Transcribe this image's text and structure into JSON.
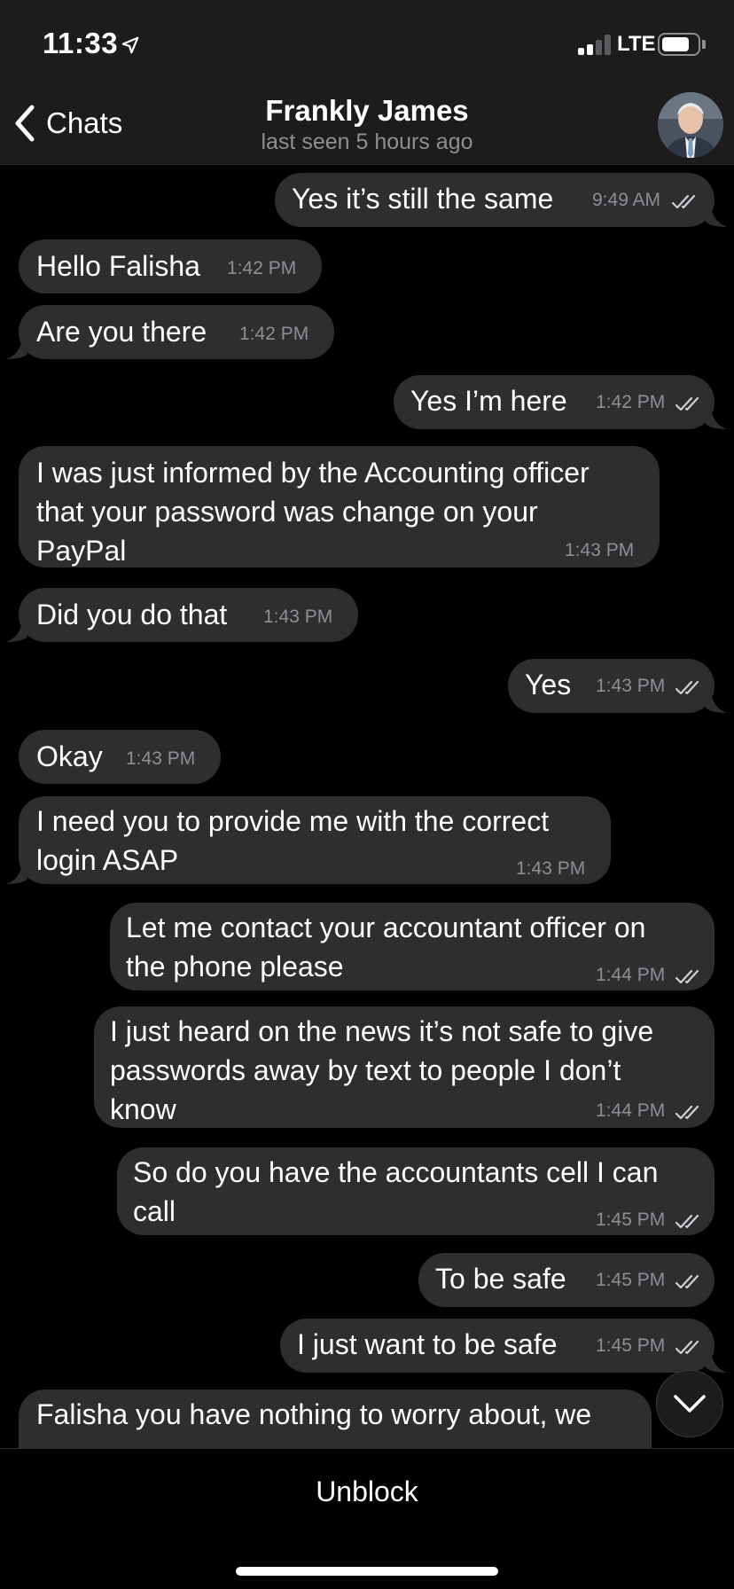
{
  "status_bar": {
    "time": "11:33",
    "network": "LTE",
    "battery_level": 0.75
  },
  "header": {
    "back_label": "Chats",
    "contact_name": "Frankly James",
    "last_seen": "last seen 5 hours ago"
  },
  "messages": [
    {
      "direction": "out",
      "text": "Yes it’s still the same",
      "time": "9:49 AM",
      "read": true
    },
    {
      "direction": "in",
      "text": "Hello Falisha",
      "time": "1:42 PM"
    },
    {
      "direction": "in",
      "text": "Are you there",
      "time": "1:42 PM"
    },
    {
      "direction": "out",
      "text": "Yes I’m here",
      "time": "1:42 PM",
      "read": true
    },
    {
      "direction": "in",
      "text": "I was just informed by the Accounting officer\nthat your password was change on your\nPayPal",
      "time": "1:43 PM"
    },
    {
      "direction": "in",
      "text": "Did you do that",
      "time": "1:43 PM"
    },
    {
      "direction": "out",
      "text": "Yes",
      "time": "1:43 PM",
      "read": true
    },
    {
      "direction": "in",
      "text": "Okay",
      "time": "1:43 PM"
    },
    {
      "direction": "in",
      "text": "I need you to provide me with the correct\nlogin ASAP",
      "time": "1:43 PM"
    },
    {
      "direction": "out",
      "text": "Let me contact your accountant officer on\nthe phone please",
      "time": "1:44 PM",
      "read": true
    },
    {
      "direction": "out",
      "text": "I just heard on the news it’s not safe to give\npasswords away by text to people I don’t\nknow",
      "time": "1:44 PM",
      "read": true
    },
    {
      "direction": "out",
      "text": "So do you have the accountants cell I can\ncall",
      "time": "1:45 PM",
      "read": true
    },
    {
      "direction": "out",
      "text": "To be safe",
      "time": "1:45 PM",
      "read": true
    },
    {
      "direction": "out",
      "text": "I just want to be safe",
      "time": "1:45 PM",
      "read": true
    },
    {
      "direction": "in",
      "text": "Falisha you have nothing to worry about, we",
      "time": ""
    }
  ],
  "footer": {
    "action_label": "Unblock"
  },
  "icons": {
    "back": "chevron-left-icon",
    "scroll_down": "chevron-down-icon",
    "location": "location-arrow-icon",
    "read_receipt": "double-check-icon"
  },
  "colors": {
    "bubble": "#2e2e30",
    "background": "#000000",
    "header": "#1c1c1d",
    "timestamp": "#8e8e93"
  }
}
